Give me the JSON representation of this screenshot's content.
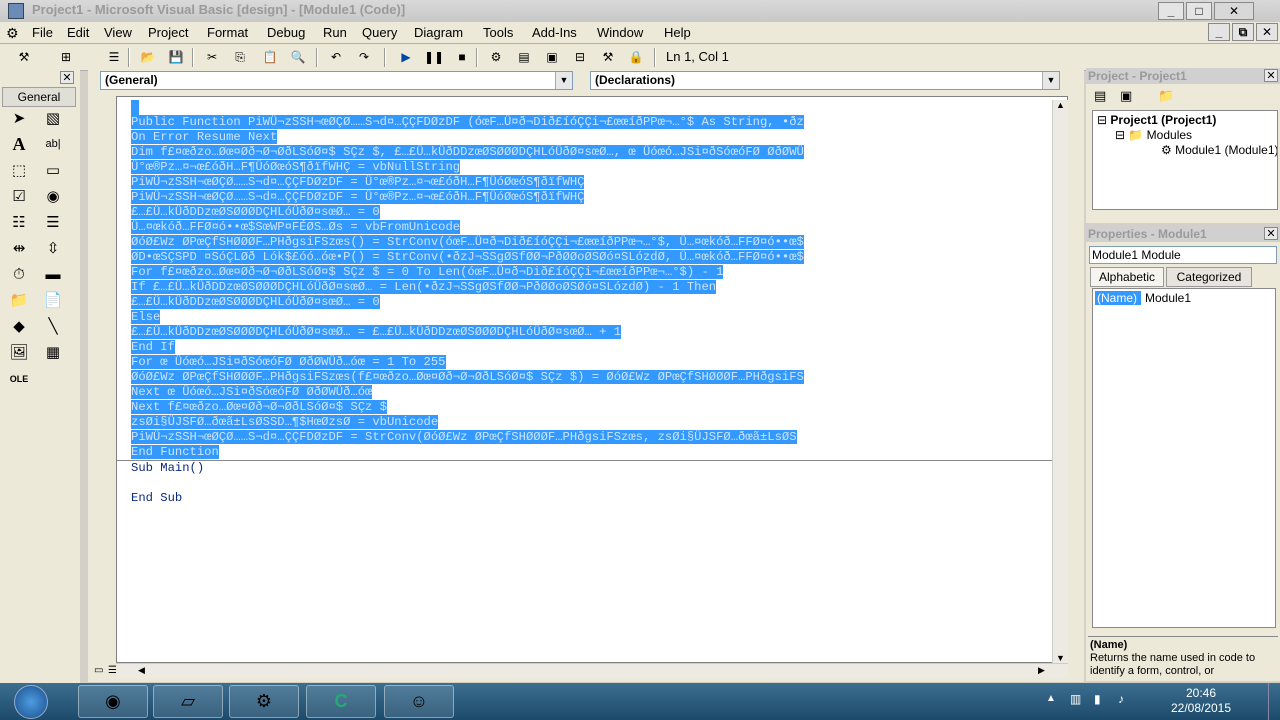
{
  "window": {
    "title": "Project1 - Microsoft Visual Basic [design] - [Module1 (Code)]",
    "buttons": [
      "_",
      "□",
      "✕"
    ],
    "inner_buttons": [
      "_",
      "⧉",
      "✕"
    ]
  },
  "menu": [
    "File",
    "Edit",
    "View",
    "Project",
    "Format",
    "Debug",
    "Run",
    "Query",
    "Diagram",
    "Tools",
    "Add-Ins",
    "Window",
    "Help"
  ],
  "toolbar": {
    "cursor_position": "Ln 1, Col 1"
  },
  "toolbox": {
    "tab": "General",
    "close": "✕"
  },
  "editor": {
    "object_combo": "(General)",
    "procedure_combo": "(Declarations)",
    "selected_lines": [
      "",
      "Public Function PiWÜ¬zSSH¬œØÇØ……S¬d¤…ÇÇFDØzDF (óœF…Ü¤ð¬Dið£íóÇÇi¬£œœíðPPœ¬…°$ As String, •ðz",
      "On Error Resume Next",
      "Dim f£¤œðzo…Øœ¤Øð¬Ø¬ØðLSóØ¤$ SÇz $, £…£Ü…kÜðDDzœØSØØØDÇHLóÜðØ¤sœØ…, œ Üóœó…JSi¤ðSóœóFØ ØðØWÜ",
      "Ü°œ®Pz…¤¬œ£óðH…F¶ÜóØœóS¶ðïfWHÇ = vbNullString",
      "PiWÜ¬zSSH¬œØÇØ……S¬d¤…ÇÇFDØzDF = Ü°œ®Pz…¤¬œ£óðH…F¶ÜóØœóS¶ðïfWHÇ",
      "PiWÜ¬zSSH¬œØÇØ……S¬d¤…ÇÇFDØzDF = Ü°œ®Pz…¤¬œ£óðH…F¶ÜóØœóS¶ðïfWHÇ",
      "£…£Ü…kÜðDDzœØSØØØDÇHLóÜðØ¤sœØ… = 0",
      "Ü…¤œkóð…FFØ¤ó••œ$SœWP¤FÉØS…Øs = vbFromUnicode",
      "ØóØ£Wz ØPœÇfSHØØØF…PHðgsiFSzœs() = StrConv(óœF…Ü¤ð¬Dið£íóÇÇi¬£œœíðPPœ¬…°$, Ü…¤œkóð…FFØ¤ó••œ$",
      "ØD•œSÇSPD ¤SóÇLØð Lók$£óó…óœ•P() = StrConv(•ðzJ¬SSgØSfØØ¬PðØØoØSØó¤SLózdØ, Ü…¤œkóð…FFØ¤ó••œ$",
      "For f£¤œðzo…Øœ¤Øð¬Ø¬ØðLSóØ¤$ SÇz $ = 0 To Len(óœF…Ü¤ð¬Dið£íóÇÇi¬£œœíðPPœ¬…°$) - 1",
      "If £…£Ü…kÜðDDzœØSØØØDÇHLóÜðØ¤sœØ… = Len(•ðzJ¬SSgØSfØØ¬PðØØoØSØó¤SLózdØ) - 1 Then",
      "£…£Ü…kÜðDDzœØSØØØDÇHLóÜðØ¤sœØ… = 0",
      "Else",
      "£…£Ü…kÜðDDzœØSØØØDÇHLóÜðØ¤sœØ… = £…£Ü…kÜðDDzœØSØØØDÇHLóÜðØ¤sœØ… + 1",
      "End If",
      "For œ Üóœó…JSi¤ðSóœóFØ ØðØWÜð…óœ = 1 To 255",
      "ØóØ£Wz ØPœÇfSHØØØF…PHðgsiFSzœs(f£¤œðzo…Øœ¤Øð¬Ø¬ØðLSóØ¤$ SÇz $) = ØóØ£Wz ØPœÇfSHØØØF…PHðgsiFS",
      "Next œ Üóœó…JSi¤ðSóœóFØ ØðØWÜð…óœ",
      "Next f£¤œðzo…Øœ¤Øð¬Ø¬ØðLSóØ¤$ SÇz $",
      "zsØi§ÜJSFØ…ðœã±LsØSSD…¶$HœØzsØ = vbUnicode",
      "PiWÜ¬zSSH¬œØÇØ……S¬d¤…ÇÇFDØzDF = StrConv(ØóØ£Wz ØPœÇfSHØØØF…PHðgsiFSzœs, zsØi§ÜJSFØ…ðœã±LsØS",
      "End Function"
    ],
    "unselected_lines": [
      "Sub Main()",
      "",
      "End Sub"
    ]
  },
  "project_explorer": {
    "title": "Project - Project1",
    "close": "✕",
    "tree": [
      "Project1 (Project1)",
      "Modules",
      "Module1 (Module1)"
    ]
  },
  "properties": {
    "title": "Properties - Module1",
    "close": "✕",
    "object": "Module1 Module",
    "tabs": [
      "Alphabetic",
      "Categorized"
    ],
    "prop_name": "(Name)",
    "prop_value": "Module1",
    "desc_title": "(Name)",
    "desc_text": "Returns the name used in code to identify a form, control, or"
  },
  "taskbar": {
    "time": "20:46",
    "date": "22/08/2015"
  }
}
